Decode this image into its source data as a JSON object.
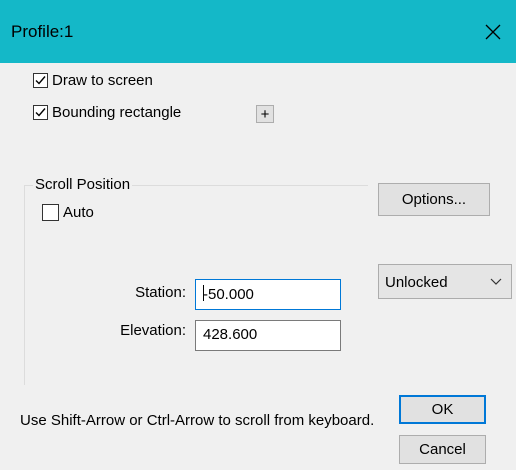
{
  "window": {
    "title": "Profile:1"
  },
  "checkboxes": {
    "draw_to_screen": {
      "label": "Draw to screen",
      "checked": true
    },
    "bounding_rectangle": {
      "label": "Bounding rectangle",
      "checked": true
    }
  },
  "plus_button": {
    "label": "+"
  },
  "scroll_position": {
    "group_label": "Scroll Position",
    "auto": {
      "label": "Auto",
      "checked": false
    },
    "station": {
      "label": "Station:",
      "value": "-50.000"
    },
    "elevation": {
      "label": "Elevation:",
      "value": "428.600"
    }
  },
  "buttons": {
    "options": "Options...",
    "ok": "OK",
    "cancel": "Cancel"
  },
  "lock_select": {
    "value": "Unlocked"
  },
  "hint": "Use Shift-Arrow or Ctrl-Arrow to scroll from keyboard.",
  "colors": {
    "titlebar": "#14b8c8",
    "focus": "#0078d7",
    "face": "#f0f0f0"
  },
  "icons": {
    "close": "close-icon",
    "check": "checkmark-icon",
    "dropdown": "chevron-down-icon"
  }
}
